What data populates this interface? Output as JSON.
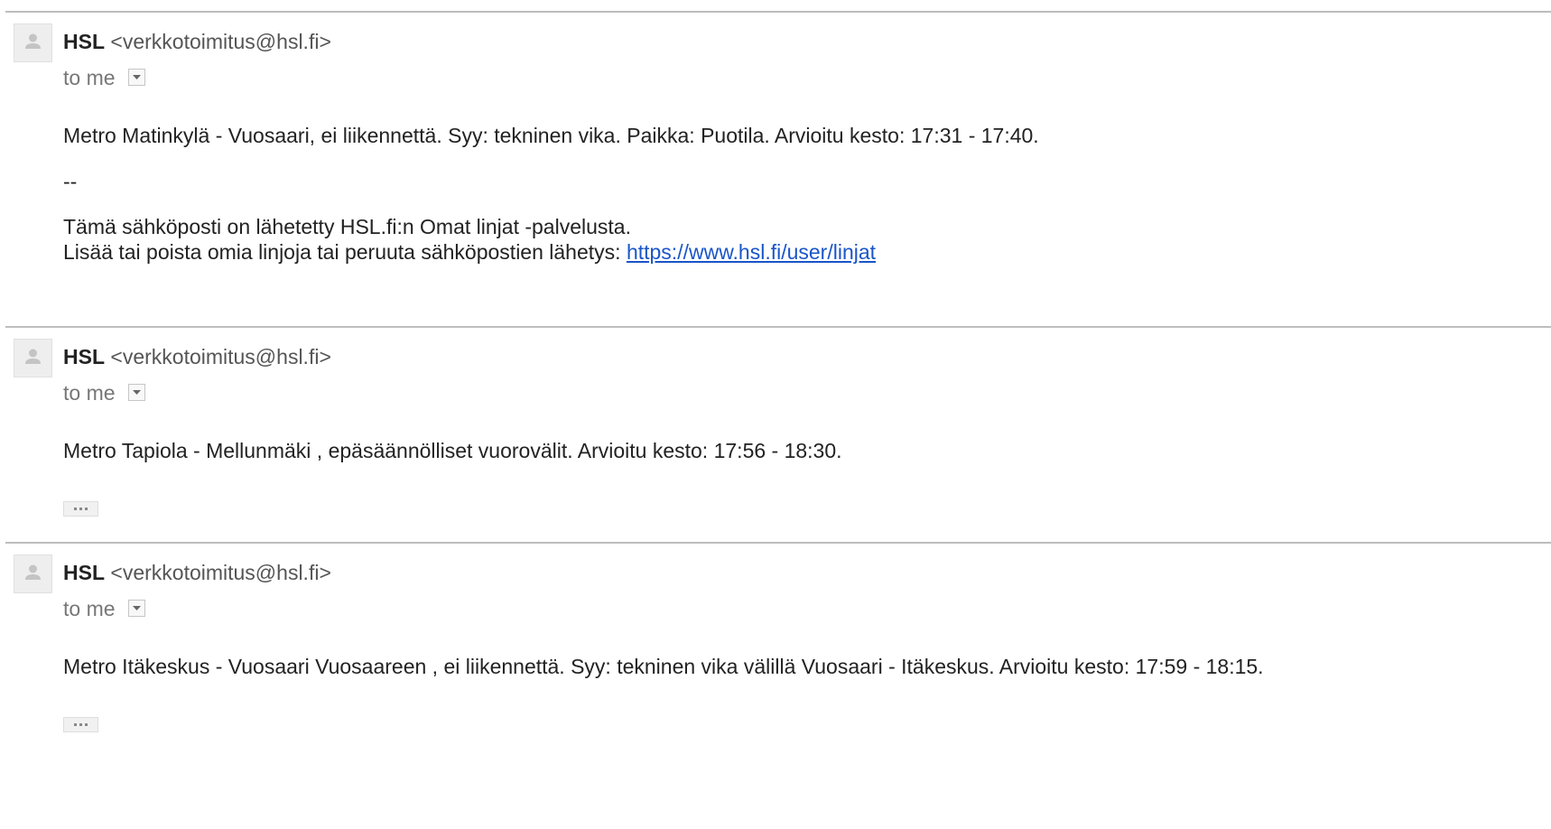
{
  "messages": [
    {
      "sender_name": "HSL",
      "sender_email": "<verkkotoimitus@hsl.fi>",
      "recipient_label": "to me",
      "body_line1": "Metro Matinkylä - Vuosaari, ei liikennettä. Syy: tekninen vika. Paikka: Puotila. Arvioitu kesto: 17:31 - 17:40.",
      "signature_separator": "--",
      "footer_line1": "Tämä sähköposti on lähetetty HSL.fi:n Omat linjat -palvelusta.",
      "footer_line2": "Lisää tai poista omia linjoja tai peruuta sähköpostien lähetys: ",
      "footer_link": "https://www.hsl.fi/user/linjat"
    },
    {
      "sender_name": "HSL",
      "sender_email": "<verkkotoimitus@hsl.fi>",
      "recipient_label": "to me",
      "body_line1": "Metro Tapiola - Mellunmäki , epäsäännölliset vuorovälit. Arvioitu kesto: 17:56 - 18:30."
    },
    {
      "sender_name": "HSL",
      "sender_email": "<verkkotoimitus@hsl.fi>",
      "recipient_label": "to me",
      "body_line1": "Metro Itäkeskus - Vuosaari Vuosaareen , ei liikennettä. Syy: tekninen vika välillä Vuosaari - Itäkeskus. Arvioitu kesto: 17:59 - 18:15."
    }
  ],
  "icons": {
    "avatar": "default-person-icon",
    "details_toggle": "chevron-down-icon",
    "show_trimmed": "ellipsis-icon"
  },
  "colors": {
    "link": "#1a55c9",
    "divider": "#bdbdbd",
    "muted_text": "#777777"
  }
}
